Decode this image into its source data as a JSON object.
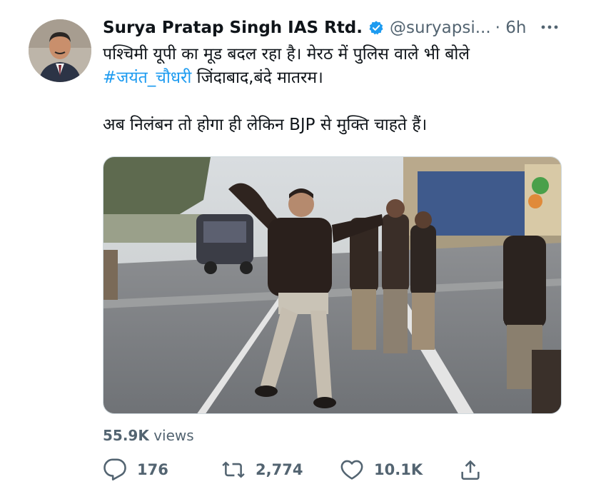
{
  "tweet": {
    "author_name": "Surya Pratap Singh IAS Rtd.",
    "handle": "@suryapsi...",
    "time": "· 6h",
    "verified_color": "#1d9bf0",
    "text_line1": "पश्चिमी यूपी का मूड बदल रहा है। मेरठ में पुलिस वाले भी बोले",
    "hashtag": "#जयंत_चौधरी",
    "text_line2_rest": " जिंदाबाद,बंदे मातरम।",
    "text_line3": "अब निलंबन तो होगा ही लेकिन BJP से मुक्ति चाहते हैं।",
    "views_count": "55.9K",
    "views_label": " views"
  },
  "actions": {
    "replies": "176",
    "retweets": "2,774",
    "likes": "10.1K"
  },
  "icons": {
    "more": "more-icon",
    "reply": "reply-icon",
    "retweet": "retweet-icon",
    "like": "heart-icon",
    "share": "share-icon"
  }
}
